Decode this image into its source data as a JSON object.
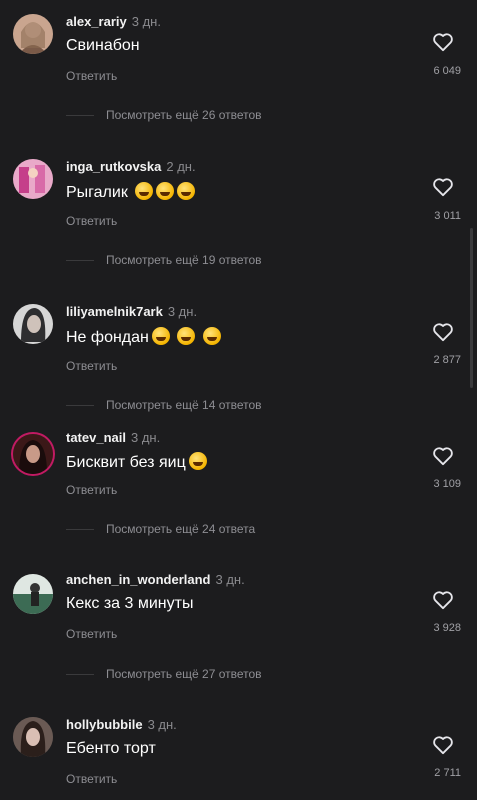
{
  "reply_label": "Ответить",
  "comments": [
    {
      "username": "alex_rariy",
      "time": "3 дн.",
      "text": "Свинабон",
      "emojis": 0,
      "likes": "6 049",
      "more": "Посмотреть ещё 26 ответов",
      "avatar_color": "#b98d7a"
    },
    {
      "username": "inga_rutkovska",
      "time": "2 дн.",
      "text": "Рыгалик",
      "emojis": 3,
      "likes": "3 011",
      "more": "Посмотреть ещё 19 ответов",
      "avatar_color": "#c26a9a"
    },
    {
      "username": "liliyamelnik7ark",
      "time": "3 дн.",
      "text": "Не фондан",
      "emojis": 3,
      "likes": "2 877",
      "more": "Посмотреть ещё 14 ответов",
      "avatar_color": "#6e6e72"
    },
    {
      "username": "tatev_nail",
      "time": "3 дн.",
      "text": "Бисквит без яиц",
      "emojis": 1,
      "likes": "3 109",
      "more": "Посмотреть ещё 24 ответа",
      "avatar_color": "#3a2020"
    },
    {
      "username": "anchen_in_wonderland",
      "time": "3 дн.",
      "text": "Кекс за 3 минуты",
      "emojis": 0,
      "likes": "3 928",
      "more": "Посмотреть ещё 27 ответов",
      "avatar_color": "#4a6a5a"
    },
    {
      "username": "hollybubbile",
      "time": "3 дн.",
      "text": "Ебенто торт",
      "emojis": 0,
      "likes": "2 711",
      "more": "",
      "avatar_color": "#5a4a44"
    }
  ]
}
